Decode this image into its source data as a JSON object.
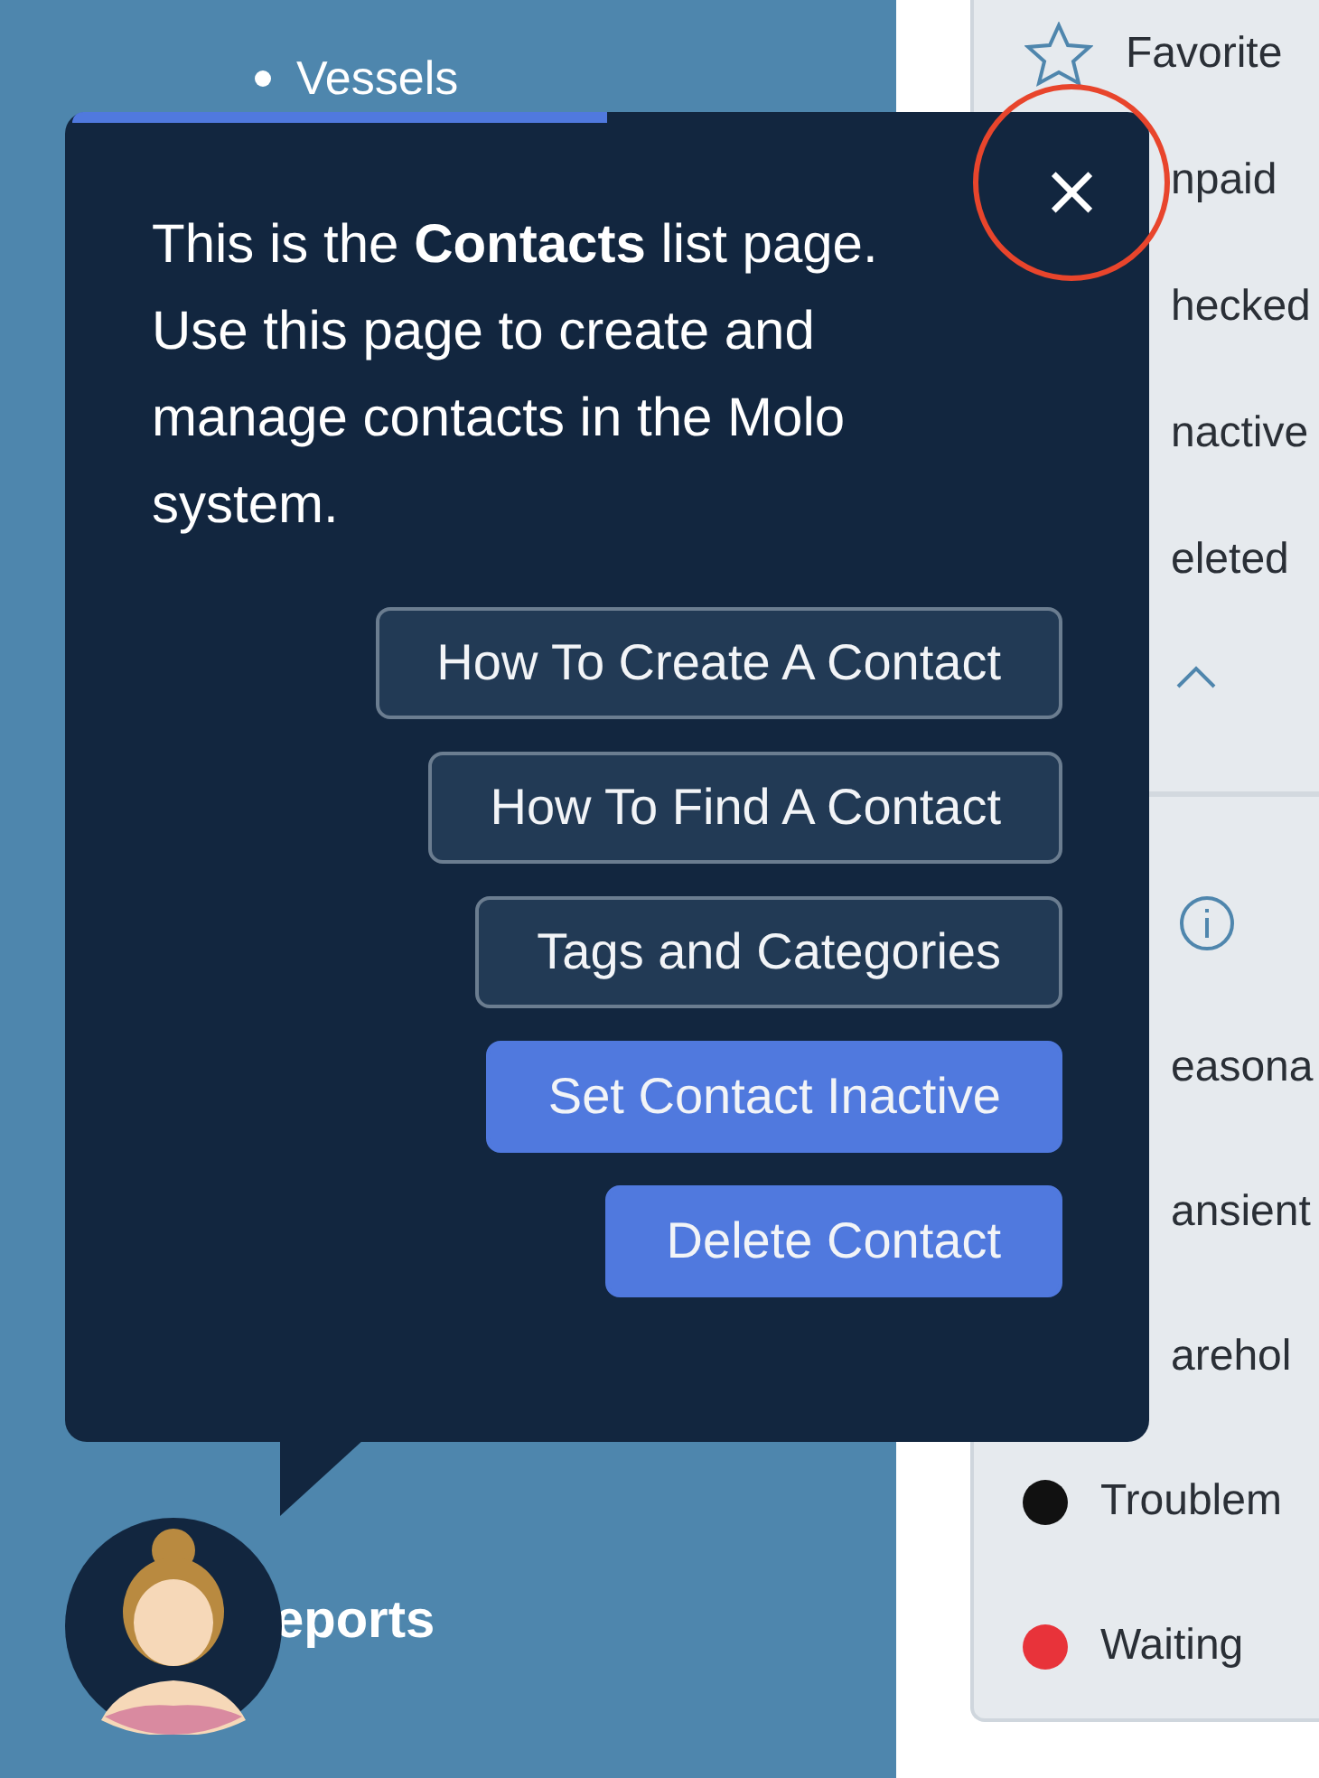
{
  "sidebar": {
    "items": [
      {
        "kind": "bullet",
        "label": "Vessels"
      },
      {
        "kind": "section",
        "label": "eports"
      }
    ]
  },
  "tour_popover": {
    "message": "This is the **Contacts** list page. Use this page to create and manage contacts in the Molo system.",
    "close_label": "×",
    "buttons": [
      {
        "kind": "outline",
        "label": "How To Create A Contact"
      },
      {
        "kind": "outline",
        "label": "How To Find A Contact"
      },
      {
        "kind": "outline",
        "label": "Tags and Categories"
      },
      {
        "kind": "primary",
        "label": "Set Contact Inactive"
      },
      {
        "kind": "primary",
        "label": "Delete Contact"
      }
    ]
  },
  "filter_panel": {
    "items": [
      {
        "kind": "star",
        "label": "Favorite"
      },
      {
        "kind": "covered",
        "label": "npaid"
      },
      {
        "kind": "covered",
        "label": "hecked"
      },
      {
        "kind": "covered",
        "label": "nactive"
      },
      {
        "kind": "covered",
        "label": "eleted"
      },
      {
        "kind": "collapse"
      },
      {
        "kind": "info"
      },
      {
        "kind": "covered",
        "label": "easona"
      },
      {
        "kind": "covered",
        "label": "ansient"
      },
      {
        "kind": "covered",
        "label": "arehol"
      },
      {
        "kind": "dot",
        "label": "Troublem",
        "color": "#111111"
      },
      {
        "kind": "dot",
        "label": "Waiting",
        "color": "#e8333a"
      }
    ]
  }
}
